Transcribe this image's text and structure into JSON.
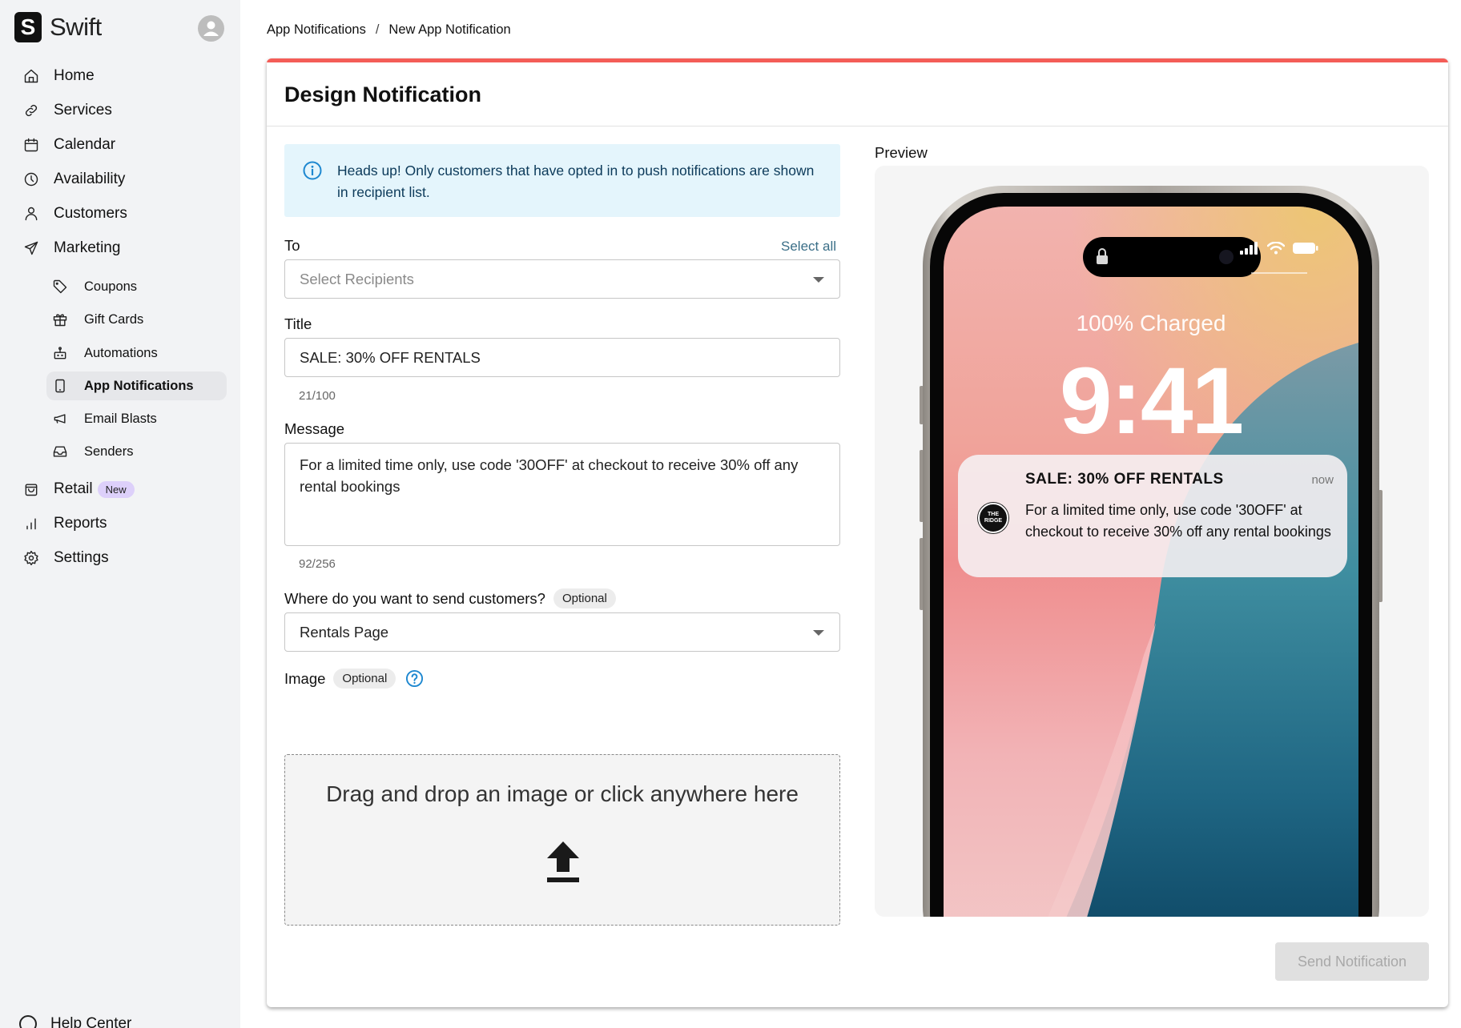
{
  "app": {
    "name": "Swift",
    "logo_letter": "S"
  },
  "sidebar": {
    "items": [
      {
        "label": "Home",
        "icon": "home-icon"
      },
      {
        "label": "Services",
        "icon": "link-icon"
      },
      {
        "label": "Calendar",
        "icon": "calendar-icon"
      },
      {
        "label": "Availability",
        "icon": "clock-icon"
      },
      {
        "label": "Customers",
        "icon": "user-icon"
      },
      {
        "label": "Marketing",
        "icon": "send-icon"
      },
      {
        "label": "Coupons",
        "icon": "tag-icon"
      },
      {
        "label": "Gift Cards",
        "icon": "gift-icon"
      },
      {
        "label": "Automations",
        "icon": "robot-icon"
      },
      {
        "label": "App Notifications",
        "icon": "phone-icon",
        "active": true
      },
      {
        "label": "Email Blasts",
        "icon": "megaphone-icon"
      },
      {
        "label": "Senders",
        "icon": "inbox-icon"
      },
      {
        "label": "Retail",
        "icon": "bag-icon",
        "badge": "New"
      },
      {
        "label": "Reports",
        "icon": "bar-chart-icon"
      },
      {
        "label": "Settings",
        "icon": "gear-icon"
      }
    ],
    "help_center": "Help Center"
  },
  "breadcrumb": {
    "parent": "App Notifications",
    "separator": "/",
    "current": "New App Notification"
  },
  "card": {
    "title": "Design Notification",
    "accent_color": "#f45d57"
  },
  "form": {
    "info_banner": "Heads up! Only customers that have opted in to push notifications are shown in recipient list.",
    "to": {
      "label": "To",
      "select_all": "Select all",
      "placeholder": "Select Recipients"
    },
    "title": {
      "label": "Title",
      "value": "SALE: 30% OFF RENTALS",
      "counter": "21/100"
    },
    "message": {
      "label": "Message",
      "value": "For a limited time only, use code '30OFF' at checkout to receive 30% off any rental bookings",
      "counter": "92/256"
    },
    "destination": {
      "label": "Where do you want to send customers?",
      "optional": "Optional",
      "value": "Rentals Page"
    },
    "image": {
      "label": "Image",
      "optional": "Optional",
      "dropzone_text": "Drag and drop an image or click anywhere here"
    }
  },
  "preview": {
    "label": "Preview",
    "charged_text": "100% Charged",
    "clock": "9:41",
    "notification": {
      "title": "SALE: 30% OFF RENTALS",
      "time": "now",
      "body": "For a limited time only, use code '30OFF' at checkout to receive 30% off any rental bookings",
      "logo_text": "THE RIDGE"
    }
  },
  "actions": {
    "send_label": "Send Notification"
  }
}
